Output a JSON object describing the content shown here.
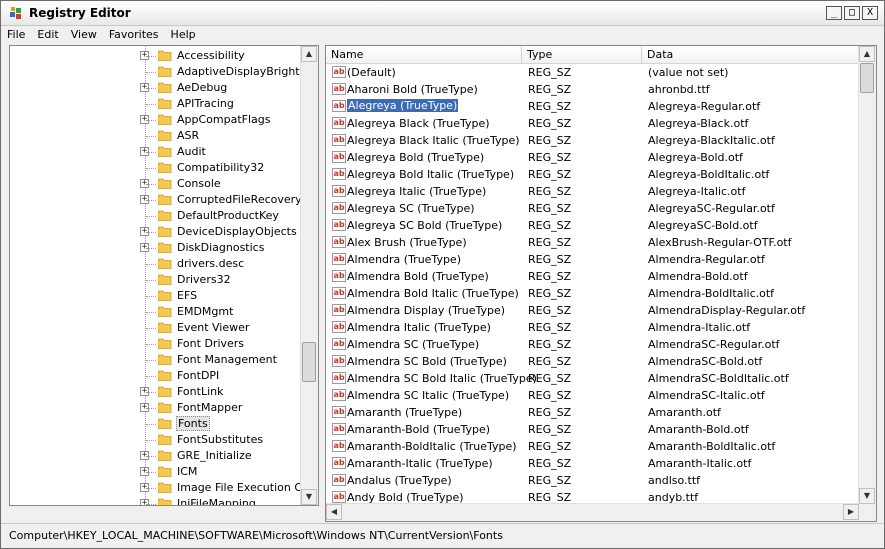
{
  "window": {
    "title": "Registry Editor",
    "min_glyph": "_",
    "max_glyph": "□",
    "close_glyph": "X"
  },
  "menu": [
    "File",
    "Edit",
    "View",
    "Favorites",
    "Help"
  ],
  "tree": {
    "items": [
      {
        "label": "Accessibility",
        "expandable": true
      },
      {
        "label": "AdaptiveDisplayBrightness",
        "expandable": false
      },
      {
        "label": "AeDebug",
        "expandable": true
      },
      {
        "label": "APITracing",
        "expandable": false
      },
      {
        "label": "AppCompatFlags",
        "expandable": true
      },
      {
        "label": "ASR",
        "expandable": false
      },
      {
        "label": "Audit",
        "expandable": true
      },
      {
        "label": "Compatibility32",
        "expandable": false
      },
      {
        "label": "Console",
        "expandable": true
      },
      {
        "label": "CorruptedFileRecovery",
        "expandable": true
      },
      {
        "label": "DefaultProductKey",
        "expandable": false
      },
      {
        "label": "DeviceDisplayObjects",
        "expandable": true
      },
      {
        "label": "DiskDiagnostics",
        "expandable": true
      },
      {
        "label": "drivers.desc",
        "expandable": false
      },
      {
        "label": "Drivers32",
        "expandable": false
      },
      {
        "label": "EFS",
        "expandable": false
      },
      {
        "label": "EMDMgmt",
        "expandable": false
      },
      {
        "label": "Event Viewer",
        "expandable": false
      },
      {
        "label": "Font Drivers",
        "expandable": false
      },
      {
        "label": "Font Management",
        "expandable": false
      },
      {
        "label": "FontDPI",
        "expandable": false
      },
      {
        "label": "FontLink",
        "expandable": true
      },
      {
        "label": "FontMapper",
        "expandable": true
      },
      {
        "label": "Fonts",
        "expandable": false,
        "selected": true
      },
      {
        "label": "FontSubstitutes",
        "expandable": false
      },
      {
        "label": "GRE_Initialize",
        "expandable": true
      },
      {
        "label": "ICM",
        "expandable": true
      },
      {
        "label": "Image File Execution Option",
        "expandable": true
      },
      {
        "label": "IniFileMapping",
        "expandable": true
      }
    ]
  },
  "list": {
    "columns": {
      "name": "Name",
      "type": "Type",
      "data": "Data"
    },
    "rows": [
      {
        "name": "(Default)",
        "type": "REG_SZ",
        "data": "(value not set)"
      },
      {
        "name": "Aharoni Bold (TrueType)",
        "type": "REG_SZ",
        "data": "ahronbd.ttf"
      },
      {
        "name": "Alegreya (TrueType)",
        "type": "REG_SZ",
        "data": "Alegreya-Regular.otf",
        "selected": true
      },
      {
        "name": "Alegreya Black (TrueType)",
        "type": "REG_SZ",
        "data": "Alegreya-Black.otf"
      },
      {
        "name": "Alegreya Black Italic (TrueType)",
        "type": "REG_SZ",
        "data": "Alegreya-BlackItalic.otf"
      },
      {
        "name": "Alegreya Bold (TrueType)",
        "type": "REG_SZ",
        "data": "Alegreya-Bold.otf"
      },
      {
        "name": "Alegreya Bold Italic (TrueType)",
        "type": "REG_SZ",
        "data": "Alegreya-BoldItalic.otf"
      },
      {
        "name": "Alegreya Italic (TrueType)",
        "type": "REG_SZ",
        "data": "Alegreya-Italic.otf"
      },
      {
        "name": "Alegreya SC (TrueType)",
        "type": "REG_SZ",
        "data": "AlegreyaSC-Regular.otf"
      },
      {
        "name": "Alegreya SC Bold (TrueType)",
        "type": "REG_SZ",
        "data": "AlegreyaSC-Bold.otf"
      },
      {
        "name": "Alex Brush (TrueType)",
        "type": "REG_SZ",
        "data": "AlexBrush-Regular-OTF.otf"
      },
      {
        "name": "Almendra (TrueType)",
        "type": "REG_SZ",
        "data": "Almendra-Regular.otf"
      },
      {
        "name": "Almendra Bold (TrueType)",
        "type": "REG_SZ",
        "data": "Almendra-Bold.otf"
      },
      {
        "name": "Almendra Bold Italic (TrueType)",
        "type": "REG_SZ",
        "data": "Almendra-BoldItalic.otf"
      },
      {
        "name": "Almendra Display (TrueType)",
        "type": "REG_SZ",
        "data": "AlmendraDisplay-Regular.otf"
      },
      {
        "name": "Almendra Italic (TrueType)",
        "type": "REG_SZ",
        "data": "Almendra-Italic.otf"
      },
      {
        "name": "Almendra SC (TrueType)",
        "type": "REG_SZ",
        "data": "AlmendraSC-Regular.otf"
      },
      {
        "name": "Almendra SC Bold (TrueType)",
        "type": "REG_SZ",
        "data": "AlmendraSC-Bold.otf"
      },
      {
        "name": "Almendra SC Bold Italic (TrueType)",
        "type": "REG_SZ",
        "data": "AlmendraSC-BoldItalic.otf"
      },
      {
        "name": "Almendra SC Italic (TrueType)",
        "type": "REG_SZ",
        "data": "AlmendraSC-Italic.otf"
      },
      {
        "name": "Amaranth (TrueType)",
        "type": "REG_SZ",
        "data": "Amaranth.otf"
      },
      {
        "name": "Amaranth-Bold (TrueType)",
        "type": "REG_SZ",
        "data": "Amaranth-Bold.otf"
      },
      {
        "name": "Amaranth-BoldItalic (TrueType)",
        "type": "REG_SZ",
        "data": "Amaranth-BoldItalic.otf"
      },
      {
        "name": "Amaranth-Italic (TrueType)",
        "type": "REG_SZ",
        "data": "Amaranth-Italic.otf"
      },
      {
        "name": "Andalus (TrueType)",
        "type": "REG_SZ",
        "data": "andlso.ttf"
      },
      {
        "name": "Andy Bold (TrueType)",
        "type": "REG_SZ",
        "data": "andyb.ttf"
      }
    ]
  },
  "status": {
    "path": "Computer\\HKEY_LOCAL_MACHINE\\SOFTWARE\\Microsoft\\Windows NT\\CurrentVersion\\Fonts"
  },
  "icons": {
    "value_icon_text": "ab",
    "folder_color": "#f2c94c",
    "selection_color": "#3b6bb5"
  }
}
